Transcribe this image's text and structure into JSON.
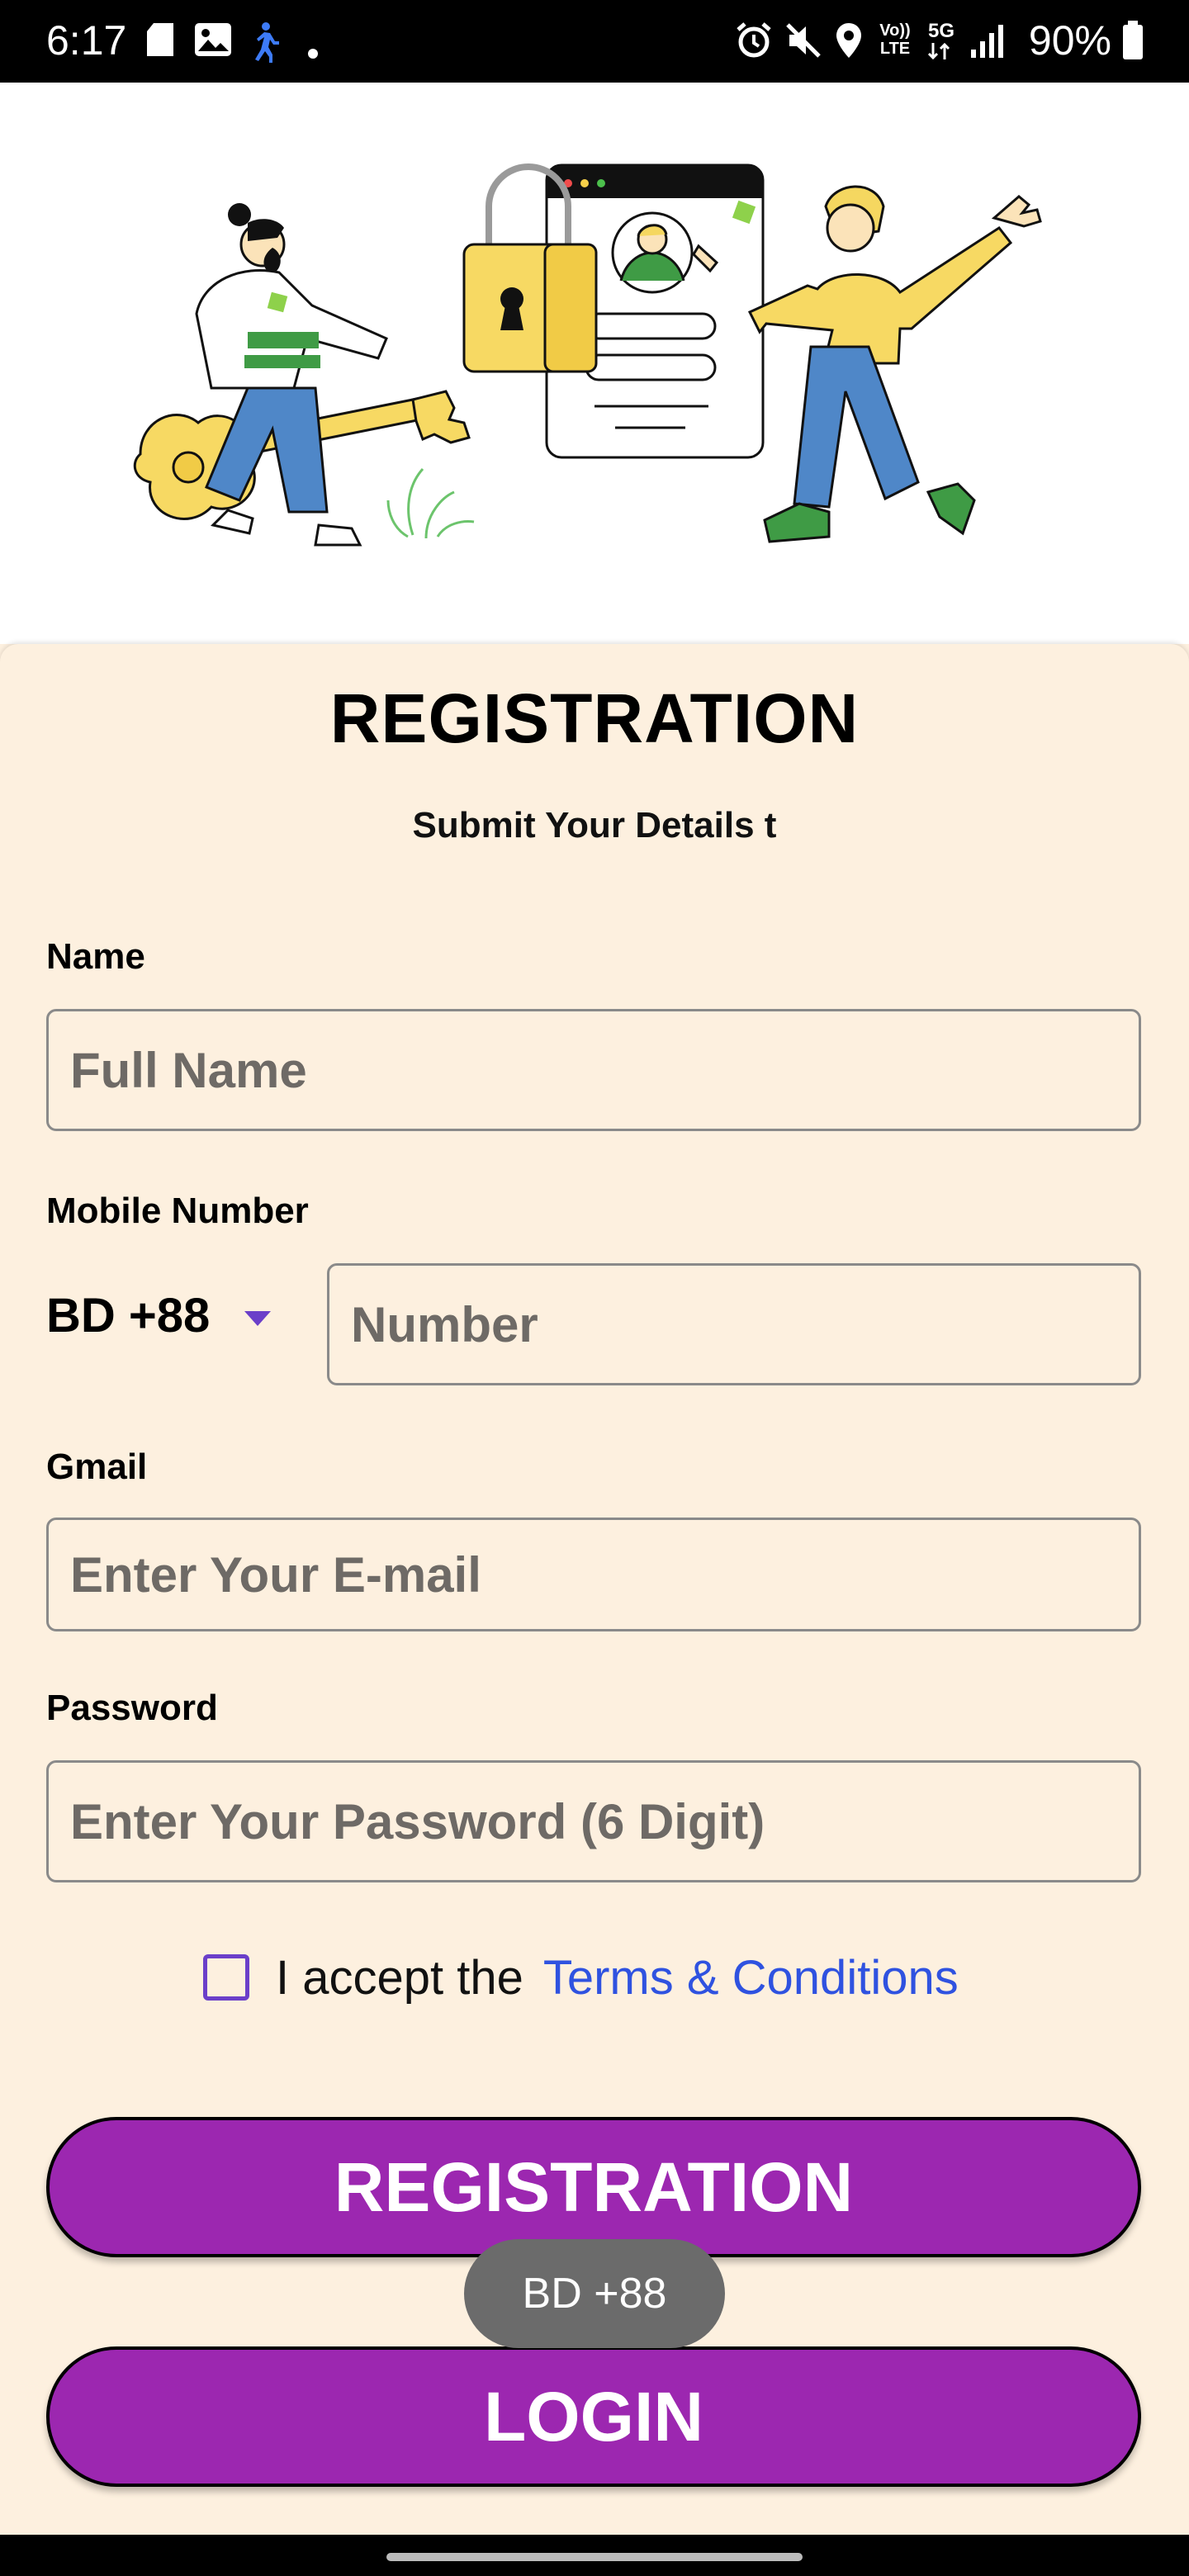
{
  "status": {
    "time": "6:17",
    "battery": "90%",
    "icons": [
      "sd-card-icon",
      "image-icon",
      "walking-icon",
      "dot-icon",
      "alarm-icon",
      "mute-icon",
      "location-icon",
      "volte-icon",
      "5g-icon",
      "signal-icon",
      "battery-icon"
    ],
    "network_5g": "5G",
    "volte": "Vo)) LTE"
  },
  "form": {
    "title": "REGISTRATION",
    "subtitle": "Submit Your Details t",
    "name_label": "Name",
    "name_placeholder": "Full Name",
    "mobile_label": "Mobile Number",
    "country_code": "BD +88",
    "number_placeholder": "Number",
    "gmail_label": "Gmail",
    "gmail_placeholder": "Enter Your E-mail",
    "password_label": "Password",
    "password_placeholder": "Enter Your Password (6 Digit)",
    "accept_text": "I accept the",
    "terms_text": "Terms & Conditions",
    "register_button": "REGISTRATION",
    "login_button": "LOGIN"
  },
  "toast": {
    "text": "BD +88"
  },
  "colors": {
    "background": "#fdf0df",
    "button": "#9c27b0",
    "link": "#2f52e0",
    "checkbox": "#6b3fc9"
  }
}
